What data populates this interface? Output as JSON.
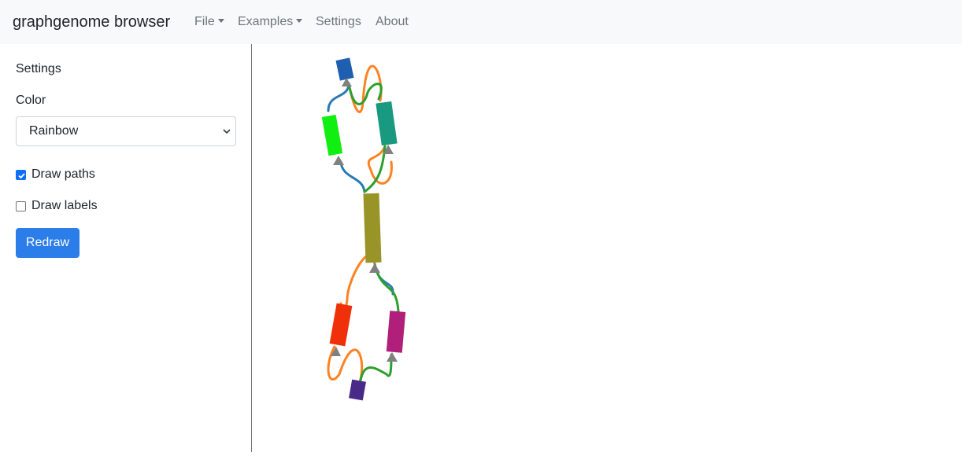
{
  "navbar": {
    "brand": "graphgenome browser",
    "items": [
      {
        "label": "File",
        "dropdown": true
      },
      {
        "label": "Examples",
        "dropdown": true
      },
      {
        "label": "Settings",
        "dropdown": false
      },
      {
        "label": "About",
        "dropdown": false
      }
    ]
  },
  "sidebar": {
    "heading": "Settings",
    "color_label": "Color",
    "color_select": {
      "value": "Rainbow"
    },
    "draw_paths": {
      "label": "Draw paths",
      "checked": true
    },
    "draw_labels": {
      "label": "Draw labels",
      "checked": false
    },
    "redraw_button": "Redraw"
  },
  "graph": {
    "node_colors": [
      "#1f5fb0",
      "#11ee11",
      "#199a80",
      "#989428",
      "#ef3008",
      "#b0207a",
      "#4a2a88"
    ],
    "path_colors": [
      "#2a7ab5",
      "#fd8222",
      "#2ca02c"
    ],
    "arrow_color": "#808080"
  }
}
